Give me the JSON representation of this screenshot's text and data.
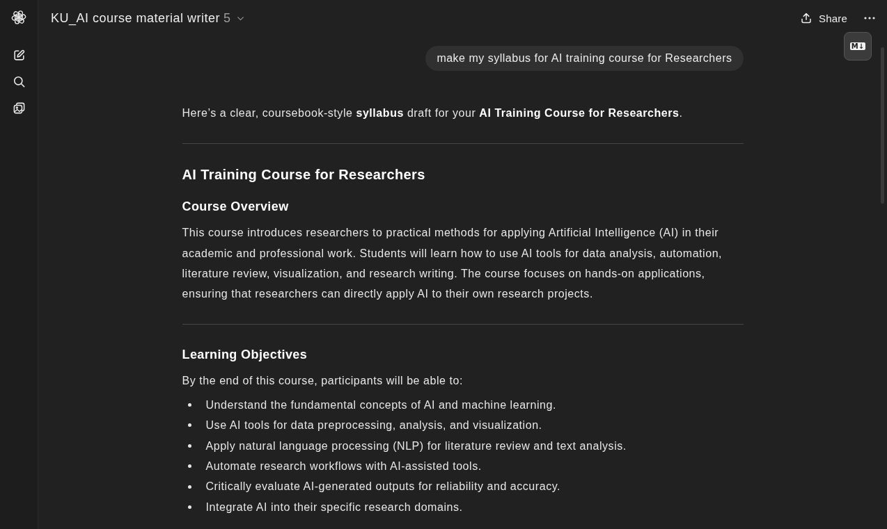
{
  "header": {
    "title": "KU_AI course material writer",
    "version": "5",
    "actions": [
      {
        "kind": "share",
        "label": "Share"
      },
      {
        "kind": "more"
      }
    ]
  },
  "markdown_button": {
    "label": "M↓"
  },
  "conversation": {
    "user_message": "make my syllabus for AI training course for Researchers",
    "response": [
      {
        "kind": "paragraph",
        "text": "Here’s a clear, coursebook-style **syllabus** draft for your **AI Training Course for Researchers**."
      },
      {
        "kind": "divider"
      },
      {
        "kind": "title",
        "text": "AI Training Course for Researchers"
      },
      {
        "kind": "heading",
        "text": "Course Overview"
      },
      {
        "kind": "paragraph",
        "text": "This course introduces researchers to practical methods for applying Artificial Intelligence (AI) in their academic and professional work. Students will learn how to use AI tools for data analysis, automation, literature review, visualization, and research writing. The course focuses on hands-on applications, ensuring that researchers can directly apply AI to their own research projects."
      },
      {
        "kind": "divider"
      },
      {
        "kind": "heading",
        "text": "Learning Objectives"
      },
      {
        "kind": "paragraph",
        "text": "By the end of this course, participants will be able to:"
      },
      {
        "kind": "list",
        "items": [
          "Understand the fundamental concepts of AI and machine learning.",
          "Use AI tools for data preprocessing, analysis, and visualization.",
          "Apply natural language processing (NLP) for literature review and text analysis.",
          "Automate research workflows with AI-assisted tools.",
          "Critically evaluate AI-generated outputs for reliability and accuracy.",
          "Integrate AI into their specific research domains."
        ]
      }
    ]
  }
}
